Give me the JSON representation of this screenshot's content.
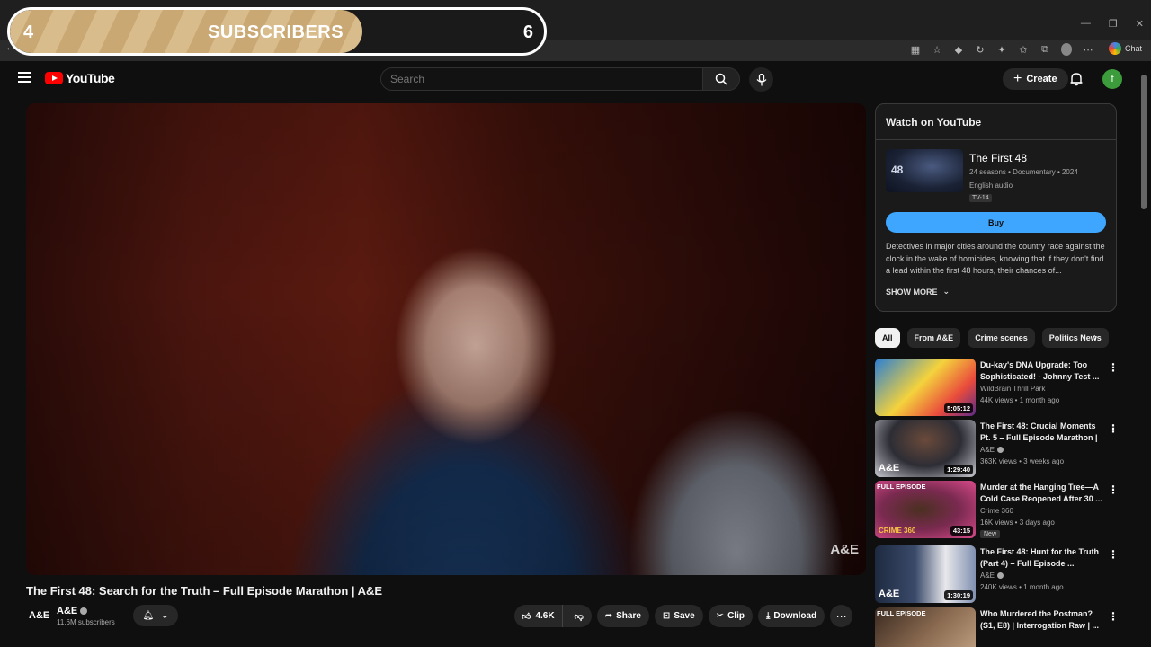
{
  "overlay": {
    "left_value": "4",
    "label": "SUBSCRIBERS",
    "right_value": "6",
    "progress_fraction": 0.66
  },
  "browser": {
    "chat_label": "Chat",
    "window_controls": [
      "—",
      "❐",
      "✕"
    ]
  },
  "header": {
    "logo_text": "YouTube",
    "search_placeholder": "Search",
    "create_label": "Create",
    "avatar_letter": "f"
  },
  "video": {
    "title": "The First 48: Search for the Truth – Full Episode Marathon | A&E",
    "watermark": "A&E",
    "channel_logo": "A&E",
    "channel_name": "A&E",
    "channel_subs": "11.6M subscribers",
    "likes": "4.6K",
    "share_label": "Share",
    "save_label": "Save",
    "clip_label": "Clip",
    "download_label": "Download"
  },
  "watch_card": {
    "heading": "Watch on YouTube",
    "thumb_text": "48",
    "show_title": "The First 48",
    "show_meta": "24 seasons • Documentary • 2024",
    "audio": "English audio",
    "rating": "TV-14",
    "buy_label": "Buy",
    "description": "Detectives in major cities around the country race against the clock in the wake of homicides, knowing that if they don't find a lead within the first 48 hours, their chances of...",
    "show_more_label": "SHOW MORE"
  },
  "chips": [
    "All",
    "From A&E",
    "Crime scenes",
    "Politics News"
  ],
  "recommendations": [
    {
      "title": "Du-kay's DNA Upgrade: Too Sophisticated! - Johnny Test ...",
      "channel": "WildBrain Thrill Park",
      "stats": "44K views • 1 month ago",
      "duration": "5:05:12",
      "badge": "",
      "logo": "",
      "is_new": ""
    },
    {
      "title": "The First 48: Crucial Moments Pt. 5 – Full Episode Marathon | ...",
      "channel": "A&E",
      "stats": "363K views • 3 weeks ago",
      "duration": "1:29:40",
      "badge": "",
      "logo": "A&E",
      "is_new": ""
    },
    {
      "title": "Murder at the Hanging Tree—A Cold Case Reopened After 30 ...",
      "channel": "Crime 360",
      "stats": "16K views • 3 days ago",
      "duration": "43:15",
      "badge": "FULL EPISODE",
      "logo": "CRIME 360",
      "is_new": "New"
    },
    {
      "title": "The First 48: Hunt for the Truth (Part 4) – Full Episode ...",
      "channel": "A&E",
      "stats": "240K views • 1 month ago",
      "duration": "1:30:19",
      "badge": "",
      "logo": "A&E",
      "is_new": ""
    },
    {
      "title": "Who Murdered the Postman? (S1, E8) | Interrogation Raw | ...",
      "channel": "",
      "stats": "",
      "duration": "",
      "badge": "FULL EPISODE",
      "logo": "",
      "is_new": ""
    }
  ],
  "colors": {
    "youtube_red": "#ff0000",
    "buy_blue": "#3ea6ff",
    "overlay_gold": "#d9bc8c"
  }
}
